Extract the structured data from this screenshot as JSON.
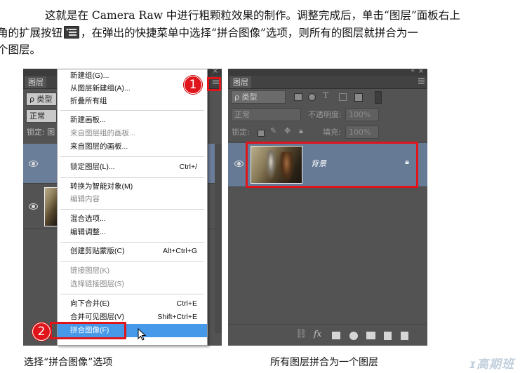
{
  "text": {
    "line1_pre": "这就是在 Camera Raw 中进行粗颗粒效果的制作。调整完成后，单击“图层”面板右上",
    "line2_pre": "角的扩展按钮",
    "line2_post": "，在弹出的快捷菜单中选择“拼合图像”选项，则所有的图层就拼合为一",
    "line3": "个图层。"
  },
  "left_panel": {
    "tab": "图层",
    "kind": "ρ 类型",
    "blend": "正常",
    "lock": "锁定: 图"
  },
  "menu": {
    "items": [
      {
        "label": "新建组(G)...",
        "shortcut": "",
        "disabled": false
      },
      {
        "label": "从图层新建组(A)...",
        "shortcut": "",
        "disabled": false
      },
      {
        "label": "折叠所有组",
        "shortcut": "",
        "disabled": false
      },
      {
        "label": "新建画板...",
        "shortcut": "",
        "disabled": false
      },
      {
        "label": "来自图层组的画板...",
        "shortcut": "",
        "disabled": true
      },
      {
        "label": "来自图层的画板...",
        "shortcut": "",
        "disabled": false
      },
      {
        "label": "锁定图层(L)...",
        "shortcut": "Ctrl+/",
        "disabled": false
      },
      {
        "label": "转换为智能对象(M)",
        "shortcut": "",
        "disabled": false
      },
      {
        "label": "编辑内容",
        "shortcut": "",
        "disabled": true
      },
      {
        "label": "混合选项...",
        "shortcut": "",
        "disabled": false
      },
      {
        "label": "编辑调整...",
        "shortcut": "",
        "disabled": false
      },
      {
        "label": "创建剪贴蒙版(C)",
        "shortcut": "Alt+Ctrl+G",
        "disabled": false
      },
      {
        "label": "链接图层(K)",
        "shortcut": "",
        "disabled": true
      },
      {
        "label": "选择链接图层(S)",
        "shortcut": "",
        "disabled": true
      },
      {
        "label": "向下合并(E)",
        "shortcut": "Ctrl+E",
        "disabled": false
      },
      {
        "label": "合并可见图层(V)",
        "shortcut": "Shift+Ctrl+E",
        "disabled": false
      },
      {
        "label": "拼合图像(F)",
        "shortcut": "",
        "disabled": false,
        "selected": true
      }
    ]
  },
  "badges": {
    "one": "1",
    "two": "2"
  },
  "right_panel": {
    "tab": "图层",
    "kind": "ρ 类型",
    "blend": "正常",
    "opacity_label": "不透明度:",
    "opacity_value": "100%",
    "lock_label": "锁定:",
    "fill_label": "填充:",
    "fill_value": "100%",
    "layer_name": "背景"
  },
  "captions": {
    "left": "选择“拼合图像”选项",
    "right": "所有图层拼合为一个图层"
  },
  "watermark": "ɪ高期班",
  "colors": {
    "accent_red": "#e0151b",
    "menu_selected": "#4599e8",
    "panel": "#535353"
  },
  "icons": [
    "eye-icon",
    "panel-menu-icon",
    "lock-icon",
    "link-icon",
    "fx-icon",
    "mask-icon",
    "adjustment-icon",
    "folder-icon",
    "new-layer-icon",
    "trash-icon",
    "cursor-icon"
  ]
}
